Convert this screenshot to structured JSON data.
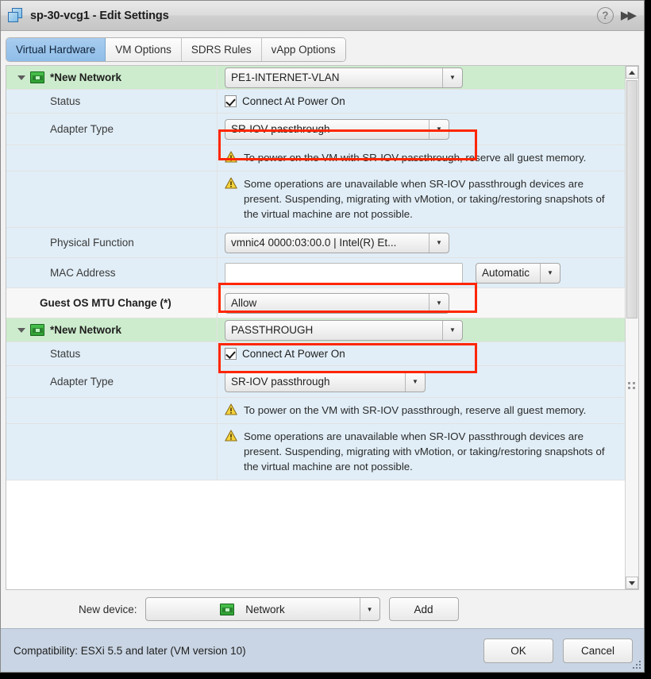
{
  "window": {
    "title": "sp-30-vcg1 - Edit Settings",
    "vm_icon": "virtual-machine-icon",
    "help_icon": "?",
    "expand_icon": "▶▶"
  },
  "tabs": [
    {
      "label": "Virtual Hardware",
      "active": true
    },
    {
      "label": "VM Options",
      "active": false
    },
    {
      "label": "SDRS Rules",
      "active": false
    },
    {
      "label": "vApp Options",
      "active": false
    }
  ],
  "devices": [
    {
      "group_label": "*New Network",
      "network_value": "PE1-INTERNET-VLAN",
      "rows": {
        "status_label": "Status",
        "status_checkbox_label": "Connect At Power On",
        "adapter_type_label": "Adapter Type",
        "adapter_type_value": "SR-IOV passthrough",
        "physical_function_label": "Physical Function",
        "physical_function_value": "vmnic4 0000:03:00.0 | Intel(R) Et...",
        "mac_address_label": "MAC Address",
        "mac_address_value": "",
        "mac_address_mode": "Automatic",
        "mtu_label": "Guest OS MTU Change (*)",
        "mtu_value": "Allow"
      },
      "warnings": [
        "To power on the VM with SR-IOV passthrough, reserve all guest memory.",
        "Some operations are unavailable when SR-IOV passthrough devices are present. Suspending, migrating with vMotion, or taking/restoring snapshots of the virtual machine are not possible."
      ]
    },
    {
      "group_label": "*New Network",
      "network_value": "PASSTHROUGH",
      "rows": {
        "status_label": "Status",
        "status_checkbox_label": "Connect At Power On",
        "adapter_type_label": "Adapter Type",
        "adapter_type_value": "SR-IOV passthrough"
      },
      "warnings": [
        "To power on the VM with SR-IOV passthrough, reserve all guest memory.",
        "Some operations are unavailable when SR-IOV passthrough devices are present. Suspending, migrating with vMotion, or taking/restoring snapshots of the virtual machine are not possible."
      ]
    }
  ],
  "new_device": {
    "label": "New device:",
    "selected": "Network",
    "icon": "network-adapter-icon",
    "add_button": "Add"
  },
  "footer": {
    "compatibility": "Compatibility: ESXi 5.5 and later (VM version 10)",
    "ok_button": "OK",
    "cancel_button": "Cancel"
  },
  "colors": {
    "highlight": "#ff2600",
    "group_row": "#cdeccd",
    "shaded_row": "#e1eef7",
    "tab_active": "#8fbde8",
    "footer": "#c9d5e4",
    "warning_icon": "#f0c419"
  },
  "icons": {
    "warning": "warning-triangle-icon",
    "dropdown_arrow": "▼",
    "scroll_up": "scroll-up-arrow",
    "scroll_down": "scroll-down-arrow"
  }
}
